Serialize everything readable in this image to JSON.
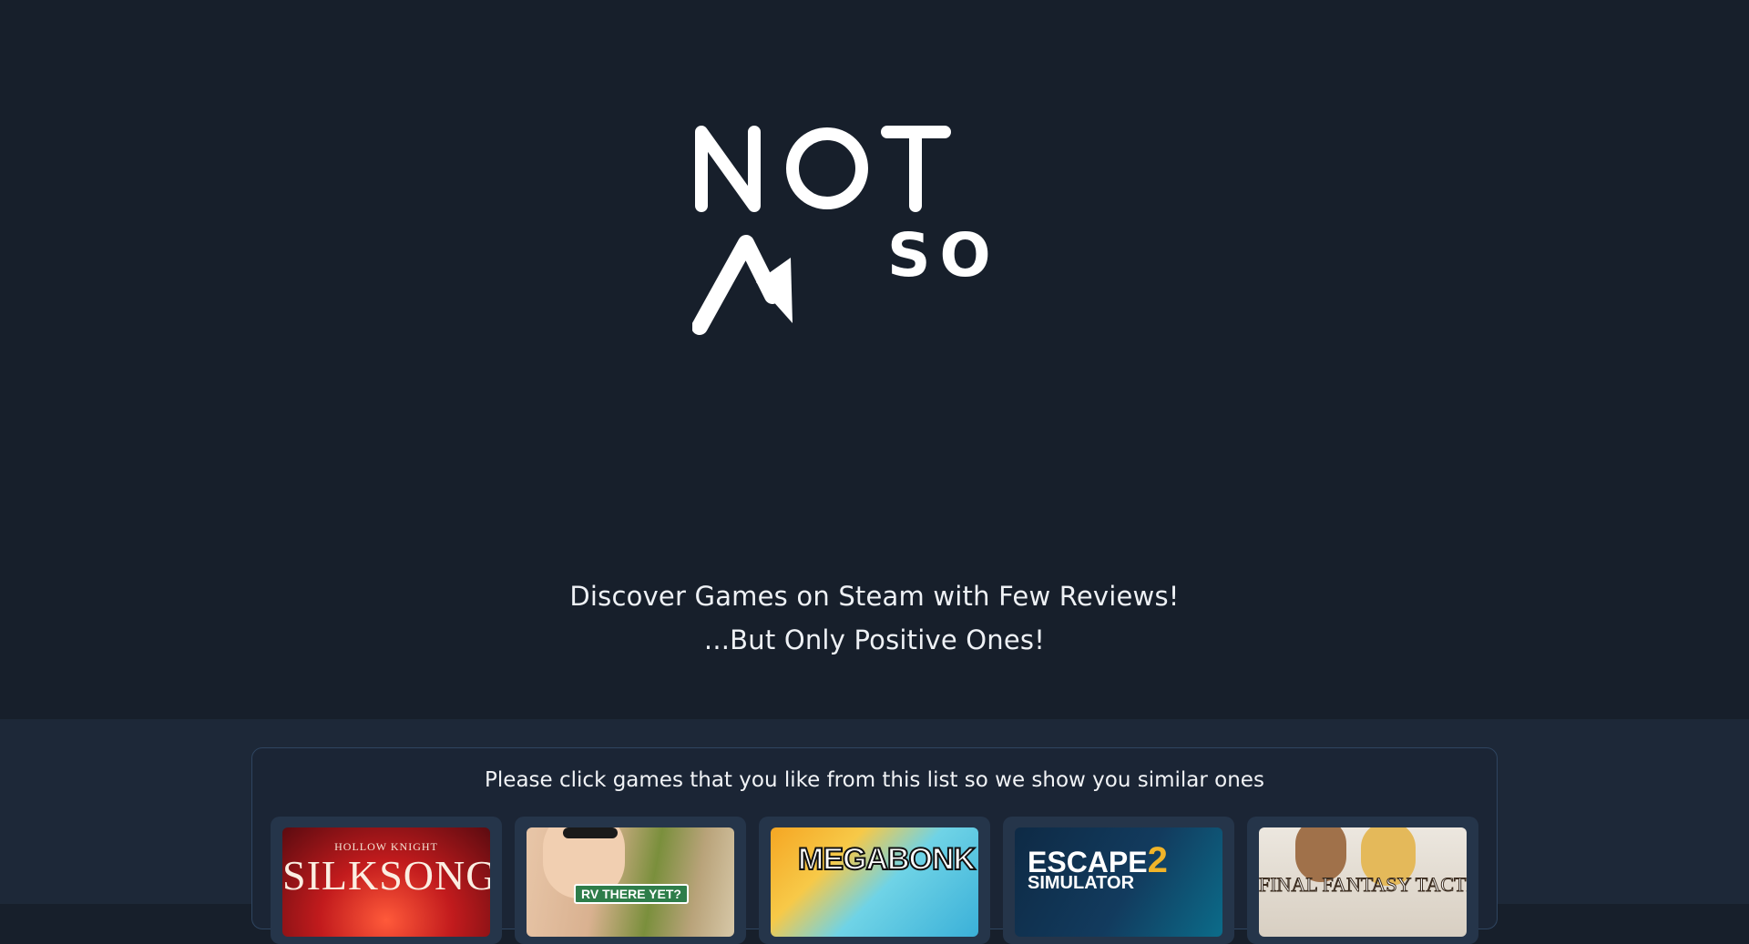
{
  "hero": {
    "logo_word_top": "NOT",
    "logo_word_small": "SO",
    "tagline_line1": "Discover Games on Steam with Few Reviews!",
    "tagline_line2": "...But Only Positive Ones!"
  },
  "picker": {
    "title": "Please click games that you like from this list so we show you similar ones",
    "games": [
      {
        "title": "SILKSONG",
        "subtitle": "HOLLOW KNIGHT"
      },
      {
        "title": "RV THERE YET?"
      },
      {
        "title": "MEGABONK"
      },
      {
        "title": "ESCAPE",
        "title_number": "2",
        "subtitle": "SIMULATOR"
      },
      {
        "title": "FINAL FANTASY TACTICS"
      }
    ]
  },
  "colors": {
    "background": "#171f2b",
    "panel": "#1d2838",
    "card": "#25354a",
    "text": "#f1f3f6"
  }
}
